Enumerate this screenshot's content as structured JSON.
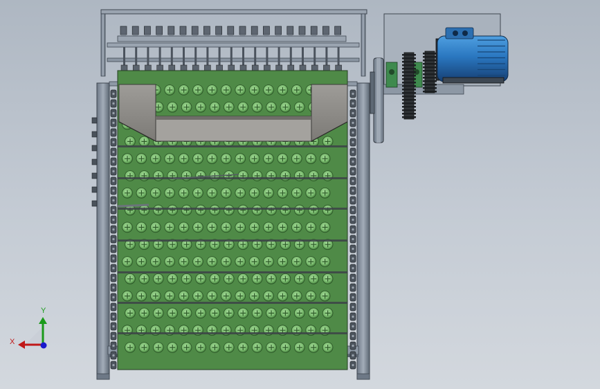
{
  "app": {
    "title": ""
  },
  "model": {
    "view": "front",
    "screen_rows": 16,
    "screen_cols": 15,
    "colors": {
      "background_top": "#aeb7c2",
      "background_bottom": "#d3d8de",
      "frame": "#7e8a98",
      "frame_dark": "#3e4650",
      "screen_green": "#5e9d55",
      "screen_green_light": "#8fc985",
      "screen_green_dark": "#2f5e2b",
      "hopper": "#8c8a86",
      "motor_blue": "#2a77c0",
      "motor_blue_dark": "#1a4f88",
      "gear_dark": "#2f3336",
      "bearing_green": "#3f8a4e"
    },
    "icons": [
      "motor-icon",
      "gearbox-icon",
      "chain-icon",
      "bearing-icon"
    ]
  },
  "triad": {
    "x_label": "X",
    "y_label": "Y",
    "colors": {
      "x": "#c01818",
      "y": "#1a9a1a",
      "z": "#1a1acc"
    }
  }
}
